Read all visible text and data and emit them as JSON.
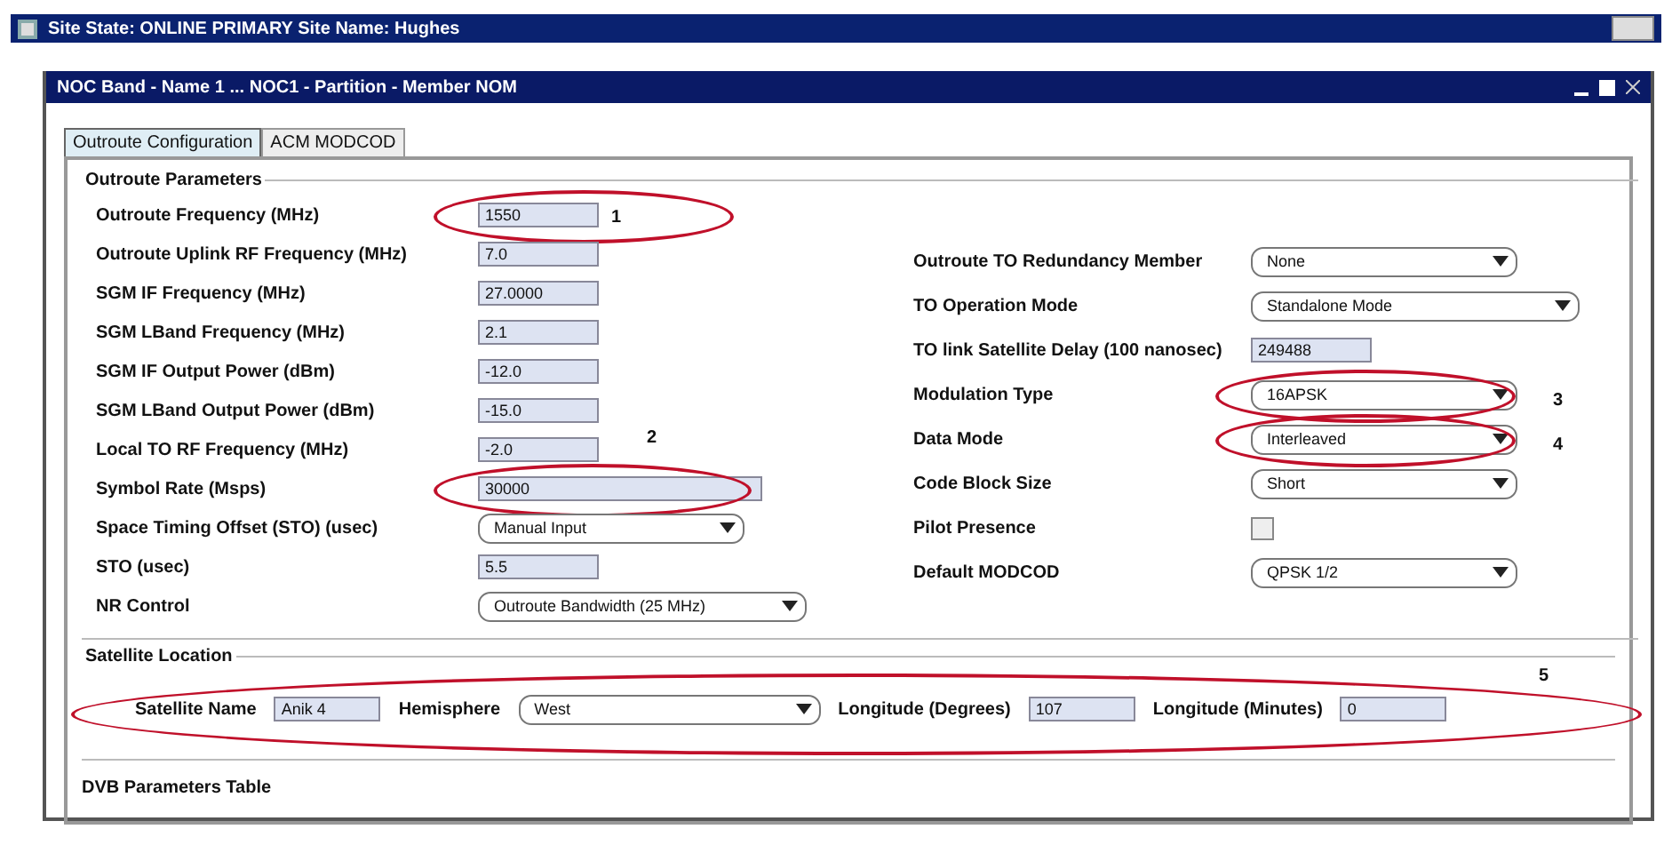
{
  "window": {
    "title": "Site State: ONLINE PRIMARY Site Name: Hughes"
  },
  "inner_window": {
    "title": "NOC Band - Name 1 ... NOC1 - Partition - Member NOM"
  },
  "tabs": [
    {
      "label": "Outroute Configuration",
      "selected": true
    },
    {
      "label": "ACM MODCOD",
      "selected": false
    }
  ],
  "outroute_parameters": {
    "title": "Outroute Parameters",
    "left": [
      {
        "kind": "text",
        "label": "Outroute Frequency (MHz)",
        "value": "1550",
        "circled": true,
        "note": "1"
      },
      {
        "kind": "text",
        "label": "Outroute Uplink RF Frequency (MHz)",
        "value": "7.0"
      },
      {
        "kind": "text",
        "label": "SGM IF Frequency (MHz)",
        "value": "27.0000"
      },
      {
        "kind": "text",
        "label": "SGM LBand Frequency (MHz)",
        "value": "2.1"
      },
      {
        "kind": "text",
        "label": "SGM IF Output Power (dBm)",
        "value": "-12.0"
      },
      {
        "kind": "text",
        "label": "SGM LBand Output Power (dBm)",
        "value": "-15.0"
      },
      {
        "kind": "text",
        "label": "Local TO RF Frequency (MHz)",
        "value": "-2.0",
        "side_note": "2"
      },
      {
        "kind": "wide",
        "label": "Symbol Rate (Msps)",
        "value": "30000",
        "circled": true
      },
      {
        "kind": "dropdown",
        "label": "Space Timing Offset (STO) (usec)",
        "value": "Manual Input"
      },
      {
        "kind": "text",
        "label": "STO (usec)",
        "value": "5.5"
      },
      {
        "kind": "dropdown_wide",
        "label": "NR Control",
        "value": "Outroute Bandwidth (25 MHz)"
      }
    ],
    "right": [
      {
        "kind": "dropdown",
        "label": "Outroute TO Redundancy Member",
        "value": "None"
      },
      {
        "kind": "dropdown_wide",
        "label": "TO Operation Mode",
        "value": "Standalone Mode"
      },
      {
        "kind": "text",
        "label": "TO link Satellite Delay (100 nanosec)",
        "value": "249488"
      },
      {
        "kind": "dropdown",
        "label": "Modulation Type",
        "value": "16APSK",
        "circled": true,
        "note": "3"
      },
      {
        "kind": "dropdown",
        "label": "Data Mode",
        "value": "Interleaved",
        "circled": true,
        "note": "4"
      },
      {
        "kind": "dropdown",
        "label": "Code Block Size",
        "value": "Short"
      },
      {
        "kind": "checkbox",
        "label": "Pilot Presence",
        "checked": false
      },
      {
        "kind": "dropdown",
        "label": "Default MODCOD",
        "value": "QPSK 1/2"
      }
    ]
  },
  "satellite_location": {
    "title": "Satellite Location",
    "note": "5",
    "satellite_name": {
      "label": "Satellite Name",
      "value": "Anik 4"
    },
    "hemisphere": {
      "label": "Hemisphere",
      "value": "West"
    },
    "longitude_degrees": {
      "label": "Longitude (Degrees)",
      "value": "107"
    },
    "longitude_minutes": {
      "label": "Longitude (Minutes)",
      "value": "0"
    }
  },
  "dvb_parameters": {
    "title": "DVB Parameters Table"
  }
}
